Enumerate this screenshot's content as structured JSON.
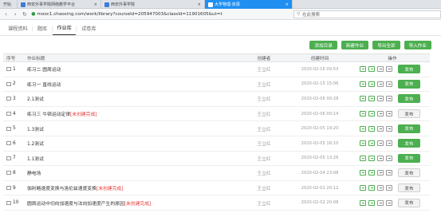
{
  "browser": {
    "tabs": [
      {
        "label": "开始",
        "active": false
      },
      {
        "label": "西安外事学院网络教学平台",
        "active": false
      },
      {
        "label": "西安外事学院",
        "active": false
      },
      {
        "label": "大学物理-资源",
        "active": true
      }
    ],
    "url": "mooc1.chaoxing.com/work/library?courseId=205947003&classId=11901605&ut=t",
    "search_placeholder": "在此搜索"
  },
  "subnav": {
    "tabs": [
      "课程资料",
      "题库",
      "作业库",
      "试卷库"
    ],
    "active": "作业库"
  },
  "actions": [
    "添加目录",
    "新建作业",
    "导出全部",
    "导入作业"
  ],
  "table": {
    "headers": {
      "num": "序号",
      "title": "作业标题",
      "creator": "创建者",
      "time": "创建时间",
      "ops": "操作"
    },
    "rows": [
      {
        "num": "1",
        "title": "练习二 圆周运动",
        "draft": "",
        "creator": "王立红",
        "time": "2020-02-16 00:53",
        "button": "发布",
        "published_style": "green"
      },
      {
        "num": "2",
        "title": "练习一 直线运动",
        "draft": "",
        "creator": "王立红",
        "time": "2020-02-15 15:06",
        "button": "发布",
        "published_style": "green"
      },
      {
        "num": "3",
        "title": "2.1测试",
        "draft": "",
        "creator": "王立红",
        "time": "2020-02-06 00:28",
        "button": "发布",
        "published_style": "green"
      },
      {
        "num": "4",
        "title": "练习三 牛顿运动定律",
        "draft": "[未创建完成]",
        "creator": "王立红",
        "time": "2020-02-06 00:14",
        "button": "发布",
        "published_style": "gray"
      },
      {
        "num": "5",
        "title": "1.3测试",
        "draft": "",
        "creator": "王立红",
        "time": "2020-02-05 19:20",
        "button": "发布",
        "published_style": "green"
      },
      {
        "num": "6",
        "title": "1.2测试",
        "draft": "",
        "creator": "王立红",
        "time": "2020-02-05 18:10",
        "button": "发布",
        "published_style": "green"
      },
      {
        "num": "7",
        "title": "1.1测试",
        "draft": "",
        "creator": "王立红",
        "time": "2020-02-05 13:26",
        "button": "发布",
        "published_style": "green"
      },
      {
        "num": "8",
        "title": "静电场",
        "draft": "",
        "creator": "王立红",
        "time": "2020-02-04 23:08",
        "button": "发布",
        "published_style": "gray"
      },
      {
        "num": "9",
        "title": "伽利略速度变换与洛伦兹速度变换",
        "draft": "[未创建完成]",
        "creator": "王立红",
        "time": "2020-02-02 20:12",
        "button": "发布",
        "published_style": "gray"
      },
      {
        "num": "10",
        "title": "圆周运动中切向加速度与法向加速度产生的原因",
        "draft": "[未创建完成]",
        "creator": "王立红",
        "time": "2020-02-02 20:08",
        "button": "发布",
        "published_style": "gray"
      }
    ]
  },
  "colors": {
    "accent": "#4caf50",
    "draft": "#e53935",
    "tab_active": "#1f8ff2"
  }
}
